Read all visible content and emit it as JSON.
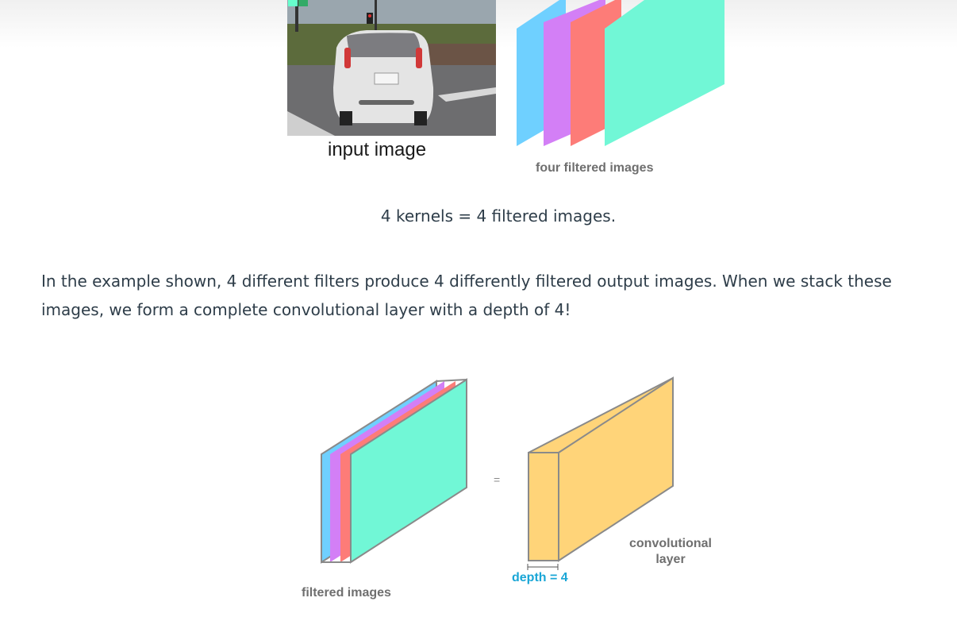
{
  "figure_top": {
    "input_label": "input image",
    "output_label": "four filtered images",
    "colors": [
      "#6fd0ff",
      "#d37ff6",
      "#fd7c78",
      "#71f7d6"
    ]
  },
  "caption": "4 kernels = 4 filtered images.",
  "paragraph": "In the example shown, 4 different filters produce 4 differently filtered output images. When we stack these images, we form a complete convolutional layer with a depth of 4!",
  "figure_bottom": {
    "filtered_label": "filtered images",
    "equals": "=",
    "depth_label": "depth = 4",
    "conv_label_line1": "convolutional",
    "conv_label_line2": "layer",
    "layer_color": "#ffd479"
  }
}
